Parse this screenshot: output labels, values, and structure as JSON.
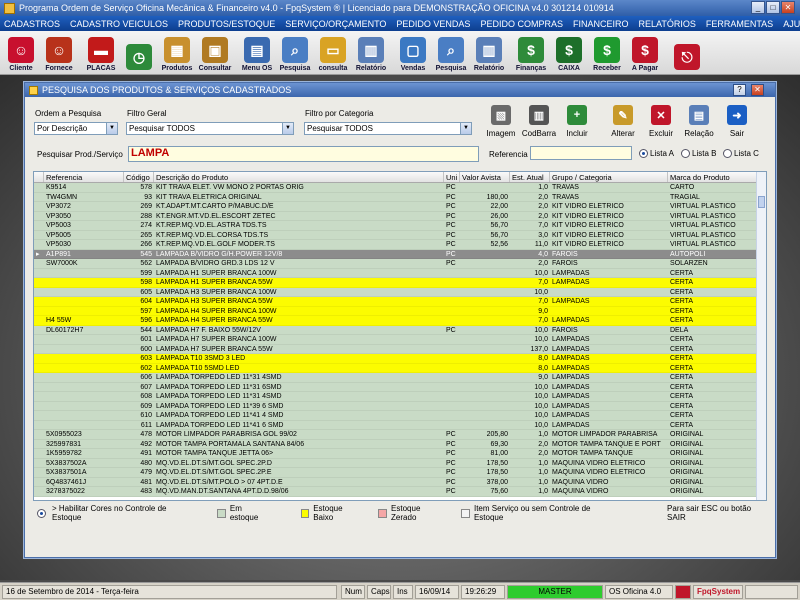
{
  "window": {
    "title": "Programa Ordem de Serviço Oficina Mecânica & Financeiro v4.0 - FpqSystem ® | Licenciado para  DEMONSTRAÇÃO OFICINA v4.0  301214 010914"
  },
  "menu": [
    "CADASTROS",
    "CADASTRO VEICULOS",
    "PRODUTOS/ESTOQUE",
    "SERVIÇO/ORÇAMENTO",
    "PEDIDO VENDAS",
    "PEDIDO COMPRAS",
    "FINANCEIRO",
    "RELATÓRIOS",
    "FERRAMENTAS",
    "AJUDA"
  ],
  "toolbar": [
    {
      "label": "Cliente",
      "icon": "person-icon",
      "color": "#c8102e"
    },
    {
      "label": "Fornece",
      "icon": "person-icon",
      "color": "#b8321a"
    },
    {
      "label": "PLACAS",
      "icon": "car-icon",
      "color": "#c21a1a"
    },
    {
      "label": "",
      "icon": "clock-icon",
      "color": "#2d8a3a"
    },
    {
      "label": "Produtos",
      "icon": "boxes-icon",
      "color": "#c8902e"
    },
    {
      "label": "Consultar",
      "icon": "box-icon",
      "color": "#b07a22"
    },
    {
      "label": "Menu OS",
      "icon": "clipboard-icon",
      "color": "#3a6ab0"
    },
    {
      "label": "Pesquisa",
      "icon": "search-doc-icon",
      "color": "#4a7ec4"
    },
    {
      "label": "consulta",
      "icon": "folder-icon",
      "color": "#d9a324"
    },
    {
      "label": "Relatório",
      "icon": "printer-icon",
      "color": "#5a7fb8"
    },
    {
      "label": "Vendas",
      "icon": "monitor-icon",
      "color": "#3b79c3"
    },
    {
      "label": "Pesquisa",
      "icon": "search-doc-icon",
      "color": "#4a7ec4"
    },
    {
      "label": "Relatório",
      "icon": "printer-icon",
      "color": "#5a7fb8"
    },
    {
      "label": "Finanças",
      "icon": "money-icon",
      "color": "#2e8b3a"
    },
    {
      "label": "CAIXA",
      "icon": "cash-icon",
      "color": "#1d6f2a"
    },
    {
      "label": "Receber",
      "icon": "dollar-green-icon",
      "color": "#1f9a2f"
    },
    {
      "label": "A Pagar",
      "icon": "dollar-red-icon",
      "color": "#c0162a"
    },
    {
      "label": "",
      "icon": "exit-icon",
      "color": "#c0162a"
    }
  ],
  "dialog": {
    "title": "PESQUISA DOS PRODUTOS & SERVIÇOS CADASTRADOS",
    "help": "?",
    "ordem_label": "Ordem a Pesquisa",
    "ordem_value": "Por Descrição",
    "filtro_label": "Filtro Geral",
    "filtro_value": "Pesquisar TODOS",
    "categoria_label": "Filtro por Categoria",
    "categoria_value": "Pesquisar TODOS",
    "pesquisa_label": "Pesquisar Prod./Serviço",
    "pesquisa_value": "LAMPA",
    "referencia_label": "Referencia",
    "referencia_value": "",
    "lists": [
      "Lista A",
      "Lista B",
      "Lista C"
    ],
    "selected_list": 0,
    "actions": [
      {
        "label": "Imagem",
        "icon": "image-icon",
        "color": "#6a6a6a"
      },
      {
        "label": "CodBarra",
        "icon": "barcode-icon",
        "color": "#555555"
      },
      {
        "label": "Incluir",
        "icon": "add-icon",
        "color": "#2e8b3a"
      },
      {
        "label": "Alterar",
        "icon": "edit-icon",
        "color": "#c89a2a"
      },
      {
        "label": "Excluir",
        "icon": "delete-icon",
        "color": "#c0162a"
      },
      {
        "label": "Relação",
        "icon": "printer-icon",
        "color": "#5a7fb8"
      },
      {
        "label": "Sair",
        "icon": "exit-arrow-icon",
        "color": "#1b5fc4"
      }
    ]
  },
  "colors": {
    "green": "#c9dbc6",
    "yellow": "#fcfc00",
    "selected": "#8c8c8c",
    "red": "#f4a6a6"
  },
  "grid": {
    "columns": [
      "Referencia",
      "Código",
      "Descrição do Produto",
      "Uni",
      "Valor Avista",
      "Est. Atual",
      "Grupo / Categoria",
      "Marca do Produto"
    ],
    "rows": [
      {
        "ref": "K9514",
        "cod": "578",
        "desc": "KIT TRAVA ELET. VW MONO 2 PORTAS ORIG",
        "uni": "PC",
        "val": "",
        "est": "1,0",
        "grp": "TRAVAS",
        "mar": "CARTO",
        "st": "green"
      },
      {
        "ref": "TW4GMN",
        "cod": "93",
        "desc": "KIT TRAVA ELETRICA ORIGINAL",
        "uni": "PC",
        "val": "180,00",
        "est": "2,0",
        "grp": "TRAVAS",
        "mar": "TRAGIAL",
        "st": "green"
      },
      {
        "ref": "VP3072",
        "cod": "269",
        "desc": "KT.ADAPT.MT.CARTO P/MABUC.D/E",
        "uni": "PC",
        "val": "22,00",
        "est": "2,0",
        "grp": "KIT VIDRO ELETRICO",
        "mar": "VIRTUAL PLASTICO",
        "st": "green"
      },
      {
        "ref": "VP3050",
        "cod": "288",
        "desc": "KT.ENGR.MT.VD.EL.ESCORT ZETEC",
        "uni": "PC",
        "val": "26,00",
        "est": "2,0",
        "grp": "KIT VIDRO ELETRICO",
        "mar": "VIRTUAL PLASTICO",
        "st": "green"
      },
      {
        "ref": "VP5003",
        "cod": "274",
        "desc": "KT.REP.MQ.VD.EL.ASTRA TDS.TS",
        "uni": "PC",
        "val": "56,70",
        "est": "7,0",
        "grp": "KIT VIDRO ELETRICO",
        "mar": "VIRTUAL PLASTICO",
        "st": "green"
      },
      {
        "ref": "VP5005",
        "cod": "265",
        "desc": "KT.REP.MQ.VD.EL.CORSA TDS.TS",
        "uni": "PC",
        "val": "56,70",
        "est": "3,0",
        "grp": "KIT VIDRO ELETRICO",
        "mar": "VIRTUAL PLASTICO",
        "st": "green"
      },
      {
        "ref": "VP5030",
        "cod": "266",
        "desc": "KT.REP.MQ.VD.EL.GOLF MODER.TS",
        "uni": "PC",
        "val": "52,56",
        "est": "11,0",
        "grp": "KIT VIDRO ELETRICO",
        "mar": "VIRTUAL PLASTICO",
        "st": "green"
      },
      {
        "ref": "A1P891",
        "cod": "545",
        "desc": "LAMPADA B/VIDRO G/H.POWER 12V/8",
        "uni": "PC",
        "val": "",
        "est": "4,0",
        "grp": "FAROIS",
        "mar": "AUTOPOLI",
        "st": "selected"
      },
      {
        "ref": "SW7000K",
        "cod": "562",
        "desc": "LAMPADA B/VIDRO GRD.3 LDS 12 V",
        "uni": "PC",
        "val": "",
        "est": "2,0",
        "grp": "FAROIS",
        "mar": "SOLARZEN",
        "st": "green"
      },
      {
        "ref": "",
        "cod": "599",
        "desc": "LAMPADA H1 SUPER BRANCA 100W",
        "uni": "",
        "val": "",
        "est": "10,0",
        "grp": "LAMPADAS",
        "mar": "CERTA",
        "st": "green"
      },
      {
        "ref": "",
        "cod": "598",
        "desc": "LAMPADA H1 SUPER BRANCA 55W",
        "uni": "",
        "val": "",
        "est": "7,0",
        "grp": "LAMPADAS",
        "mar": "CERTA",
        "st": "yellow"
      },
      {
        "ref": "",
        "cod": "605",
        "desc": "LAMPADA H3 SUPER BRANCA 100W",
        "uni": "",
        "val": "",
        "est": "10,0",
        "grp": "",
        "mar": "CERTA",
        "st": "green"
      },
      {
        "ref": "",
        "cod": "604",
        "desc": "LAMPADA H3 SUPER BRANCA 55W",
        "uni": "",
        "val": "",
        "est": "7,0",
        "grp": "LAMPADAS",
        "mar": "CERTA",
        "st": "yellow"
      },
      {
        "ref": "",
        "cod": "597",
        "desc": "LAMPADA H4 SUPER BRANCA 100W",
        "uni": "",
        "val": "",
        "est": "9,0",
        "grp": "",
        "mar": "CERTA",
        "st": "yellow"
      },
      {
        "ref": "H4 55W",
        "cod": "596",
        "desc": "LAMPADA H4 SUPER BRANCA 55W",
        "uni": "",
        "val": "",
        "est": "7,0",
        "grp": "LAMPADAS",
        "mar": "CERTA",
        "st": "yellow"
      },
      {
        "ref": "DL60172H7",
        "cod": "544",
        "desc": "LAMPADA H7 F. BAIXO 55W/12V",
        "uni": "PC",
        "val": "",
        "est": "10,0",
        "grp": "FAROIS",
        "mar": "DELA",
        "st": "green"
      },
      {
        "ref": "",
        "cod": "601",
        "desc": "LAMPADA H7 SUPER BRANCA 100W",
        "uni": "",
        "val": "",
        "est": "10,0",
        "grp": "LAMPADAS",
        "mar": "CERTA",
        "st": "green"
      },
      {
        "ref": "",
        "cod": "600",
        "desc": "LAMPADA H7 SUPER BRANCA 55W",
        "uni": "",
        "val": "",
        "est": "137,0",
        "grp": "LAMPADAS",
        "mar": "CERTA",
        "st": "green"
      },
      {
        "ref": "",
        "cod": "603",
        "desc": "LAMPADA T10 3SMD 3 LED",
        "uni": "",
        "val": "",
        "est": "8,0",
        "grp": "LAMPADAS",
        "mar": "CERTA",
        "st": "yellow"
      },
      {
        "ref": "",
        "cod": "602",
        "desc": "LAMPADA T10 5SMD LED",
        "uni": "",
        "val": "",
        "est": "8,0",
        "grp": "LAMPADAS",
        "mar": "CERTA",
        "st": "yellow"
      },
      {
        "ref": "",
        "cod": "606",
        "desc": "LAMPADA TORPEDO LED 11*31 4SMD",
        "uni": "",
        "val": "",
        "est": "9,0",
        "grp": "LAMPADAS",
        "mar": "CERTA",
        "st": "green"
      },
      {
        "ref": "",
        "cod": "607",
        "desc": "LAMPADA TORPEDO LED 11*31 6SMD",
        "uni": "",
        "val": "",
        "est": "10,0",
        "grp": "LAMPADAS",
        "mar": "CERTA",
        "st": "green"
      },
      {
        "ref": "",
        "cod": "608",
        "desc": "LAMPADA TORPEDO LED 11*31 4SMD",
        "uni": "",
        "val": "",
        "est": "10,0",
        "grp": "LAMPADAS",
        "mar": "CERTA",
        "st": "green"
      },
      {
        "ref": "",
        "cod": "609",
        "desc": "LAMPADA TORPEDO LED 11*39 6 SMD",
        "uni": "",
        "val": "",
        "est": "10,0",
        "grp": "LAMPADAS",
        "mar": "CERTA",
        "st": "green"
      },
      {
        "ref": "",
        "cod": "610",
        "desc": "LAMPADA TORPEDO LED 11*41 4 SMD",
        "uni": "",
        "val": "",
        "est": "10,0",
        "grp": "LAMPADAS",
        "mar": "CERTA",
        "st": "green"
      },
      {
        "ref": "",
        "cod": "611",
        "desc": "LAMPADA TORPEDO LED 11*41 6 SMD",
        "uni": "",
        "val": "",
        "est": "10,0",
        "grp": "LAMPADAS",
        "mar": "CERTA",
        "st": "green"
      },
      {
        "ref": "5X0955023",
        "cod": "478",
        "desc": "MOTOR LIMPADOR PARABRISA GOL 99/02",
        "uni": "PC",
        "val": "205,80",
        "est": "1,0",
        "grp": "MOTOR LIMPADOR PARABRISA",
        "mar": "ORIGINAL",
        "st": "green"
      },
      {
        "ref": "325997831",
        "cod": "492",
        "desc": "MOTOR TAMPA PORTAMALA SANTANA 84/06",
        "uni": "PC",
        "val": "69,30",
        "est": "2,0",
        "grp": "MOTOR TAMPA TANQUE E PORT",
        "mar": "ORIGINAL",
        "st": "green"
      },
      {
        "ref": "1K5959782",
        "cod": "491",
        "desc": "MOTOR TAMPA TANQUE JETTA 06>",
        "uni": "PC",
        "val": "81,00",
        "est": "2,0",
        "grp": "MOTOR TAMPA TANQUE",
        "mar": "ORIGINAL",
        "st": "green"
      },
      {
        "ref": "5X3837502A",
        "cod": "480",
        "desc": "MQ.VD.EL.DT.S/MT.GOL SPEC.2P.D",
        "uni": "PC",
        "val": "178,50",
        "est": "1,0",
        "grp": "MAQUINA VIDRO ELETRICO",
        "mar": "ORIGINAL",
        "st": "green"
      },
      {
        "ref": "5X3837501A",
        "cod": "479",
        "desc": "MQ.VD.EL.DT.S/MT.GOL SPEC.2P.E",
        "uni": "PC",
        "val": "178,50",
        "est": "1,0",
        "grp": "MAQUINA VIDRO ELETRICO",
        "mar": "ORIGINAL",
        "st": "green"
      },
      {
        "ref": "6Q4837461J",
        "cod": "481",
        "desc": "MQ.VD.EL.DT.S/MT.POLO > 07 4PT.D.E",
        "uni": "PC",
        "val": "378,00",
        "est": "1,0",
        "grp": "MAQUINA VIDRO",
        "mar": "ORIGINAL",
        "st": "green"
      },
      {
        "ref": "3278375022",
        "cod": "483",
        "desc": "MQ.VD.MAN.DT.SANTANA 4PT.D.D.98/06",
        "uni": "PC",
        "val": "75,60",
        "est": "1,0",
        "grp": "MAQUINA VIDRO",
        "mar": "ORIGINAL",
        "st": "green"
      }
    ]
  },
  "legend": {
    "habilitar": "> Habilitar Cores no Controle de Estoque",
    "em_estoque": "Em estoque",
    "estoque_baixo": "Estoque Baixo",
    "estoque_zerado": "Estoque Zerado",
    "item_servico": "Item Serviço ou sem Controle de Estoque",
    "sair_hint": "Para sair ESC ou botão SAIR"
  },
  "status": {
    "date_text": "16 de Setembro de 2014 - Terça-feira",
    "num": "Num",
    "caps": "Caps",
    "ins": "Ins",
    "date": "16/09/14",
    "time": "19:26:29",
    "master": "MASTER",
    "app": "OS Oficina 4.0",
    "brand": "FpqSystem"
  }
}
